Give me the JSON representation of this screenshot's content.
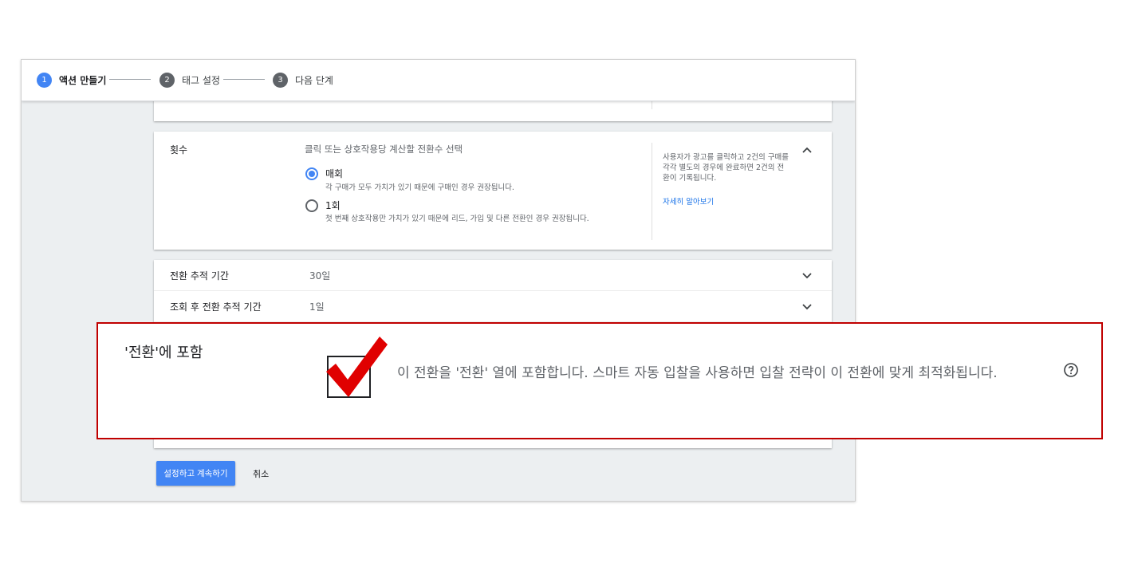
{
  "stepper": {
    "steps": [
      {
        "num": "1",
        "label": "액션 만들기"
      },
      {
        "num": "2",
        "label": "태그 설정"
      },
      {
        "num": "3",
        "label": "다음 단계"
      }
    ]
  },
  "count_section": {
    "title": "횟수",
    "description": "클릭 또는 상호작용당 계산할 전환수 선택",
    "options": [
      {
        "label": "매회",
        "help": "각 구매가 모두 가치가 있기 때문에 구매인 경우 권장됩니다.",
        "selected": true
      },
      {
        "label": "1회",
        "help": "첫 번째 상호작용만 가치가 있기 때문에 리드, 가입 및 다른 전환인 경우 권장됩니다.",
        "selected": false
      }
    ],
    "side_help": "사용자가 광고를 클릭하고 2건의 구매를 각각 별도의 경우에 완료하면 2건의 전환이 기록됩니다.",
    "learn_more": "자세히 알아보기"
  },
  "settings": [
    {
      "label": "전환 추적 기간",
      "value": "30일"
    },
    {
      "label": "조회 후 전환 추적 기간",
      "value": "1일"
    }
  ],
  "actions": {
    "primary": "설정하고 계속하기",
    "cancel": "취소"
  },
  "callout": {
    "title": "'전환'에 포함",
    "text": "이 전환을 '전환' 열에 포함합니다. 스마트 자동 입찰을 사용하면 입찰 전략이 이 전환에 맞게 최적화됩니다.",
    "checked": true
  },
  "icons": {
    "chevron_up": "chevron-up-icon",
    "chevron_down": "chevron-down-icon",
    "help": "help-circle-icon",
    "check": "red-checkmark-icon"
  },
  "colors": {
    "accent": "#4285f4",
    "step_inactive": "#5f6368",
    "callout_border": "#c00000",
    "check_red": "#e00000",
    "link": "#1a73e8"
  }
}
